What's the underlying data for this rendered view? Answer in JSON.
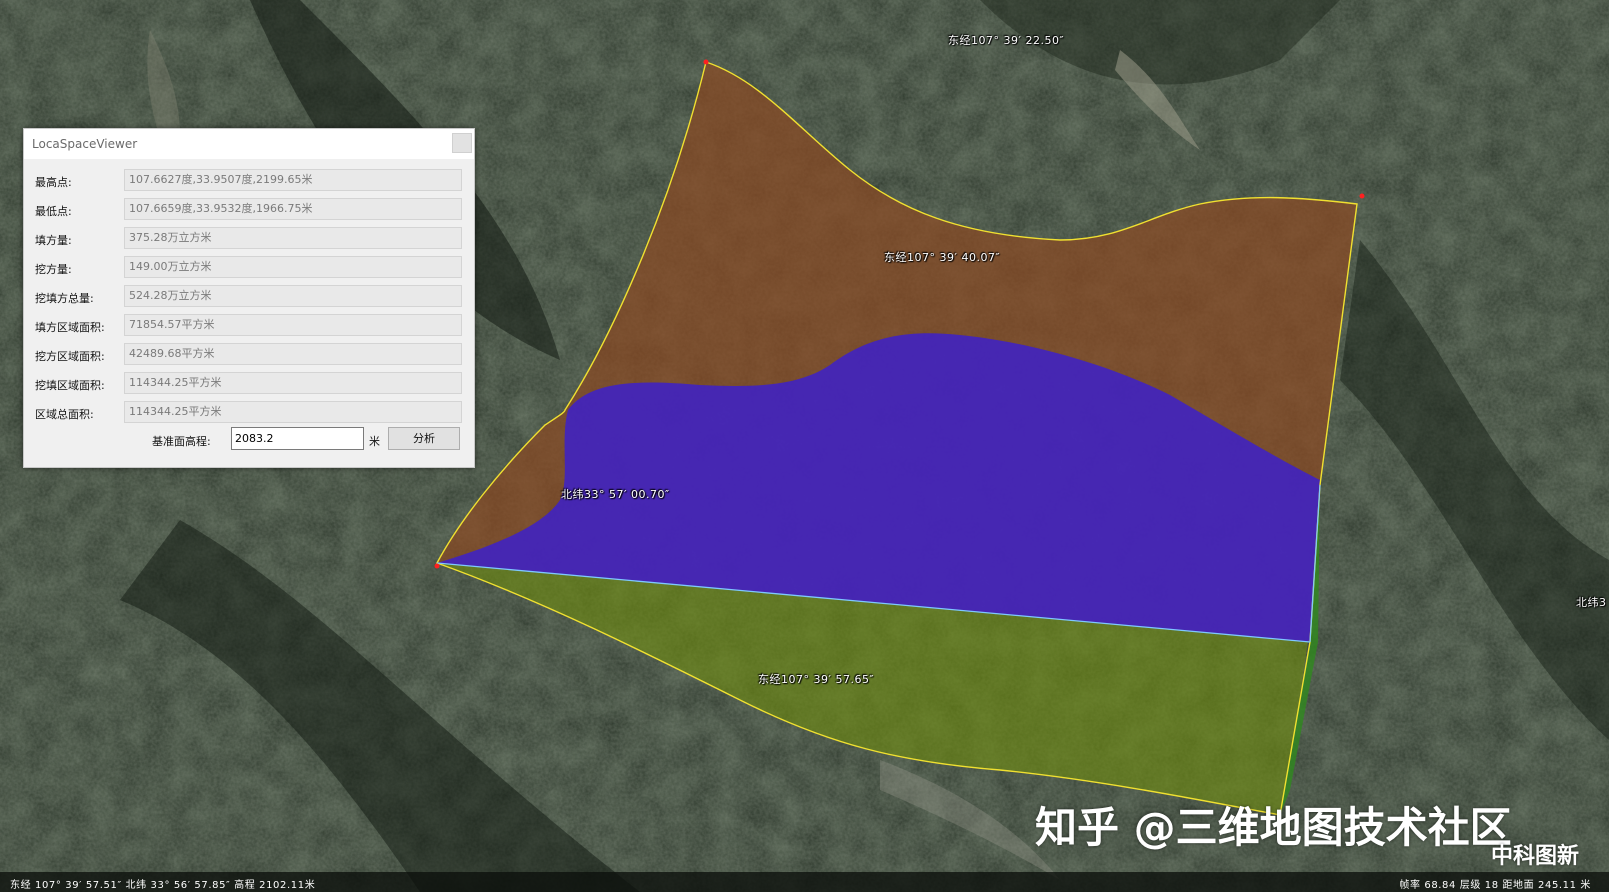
{
  "app": {
    "title": "LocaSpaceViewer"
  },
  "dialog": {
    "title": "LocaSpaceViewer",
    "close_label": "",
    "fields": [
      {
        "label": "最高点:",
        "value": "107.6627度,33.9507度,2199.65米"
      },
      {
        "label": "最低点:",
        "value": "107.6659度,33.9532度,1966.75米"
      },
      {
        "label": "填方量:",
        "value": "375.28万立方米"
      },
      {
        "label": "挖方量:",
        "value": "149.00万立方米"
      },
      {
        "label": "挖填方总量:",
        "value": "524.28万立方米"
      },
      {
        "label": "填方区域面积:",
        "value": "71854.57平方米"
      },
      {
        "label": "挖方区域面积:",
        "value": "42489.68平方米"
      },
      {
        "label": "挖填区域面积:",
        "value": "114344.25平方米"
      },
      {
        "label": "区域总面积:",
        "value": "114344.25平方米"
      }
    ],
    "base_label": "基准面高程:",
    "base_value": "2083.2",
    "base_unit": "米",
    "analyze_button": "分析"
  },
  "map": {
    "grid_labels": [
      "东经107° 39′ 22.50″",
      "东经107° 39′ 40.07″",
      "北纬33° 57′ 00.70″",
      "东经107° 39′ 57.65″",
      "北纬3"
    ],
    "colors": {
      "fill_region": "#8a4a22",
      "cut_region": "#3a1fd0",
      "base_region": "#6e8a0e",
      "boundary_line": "#f0e030",
      "base_edge_line": "#7ec8ff",
      "vertex_marker": "#ff2020"
    }
  },
  "watermark": {
    "main": "知乎 @三维地图技术社区",
    "sub": "中科图新"
  },
  "status": {
    "left": "东经 107° 39′ 57.51″ 北纬 33° 56′ 57.85″ 高程 2102.11米",
    "right": "帧率 68.84 层级 18 距地面 245.11 米"
  }
}
